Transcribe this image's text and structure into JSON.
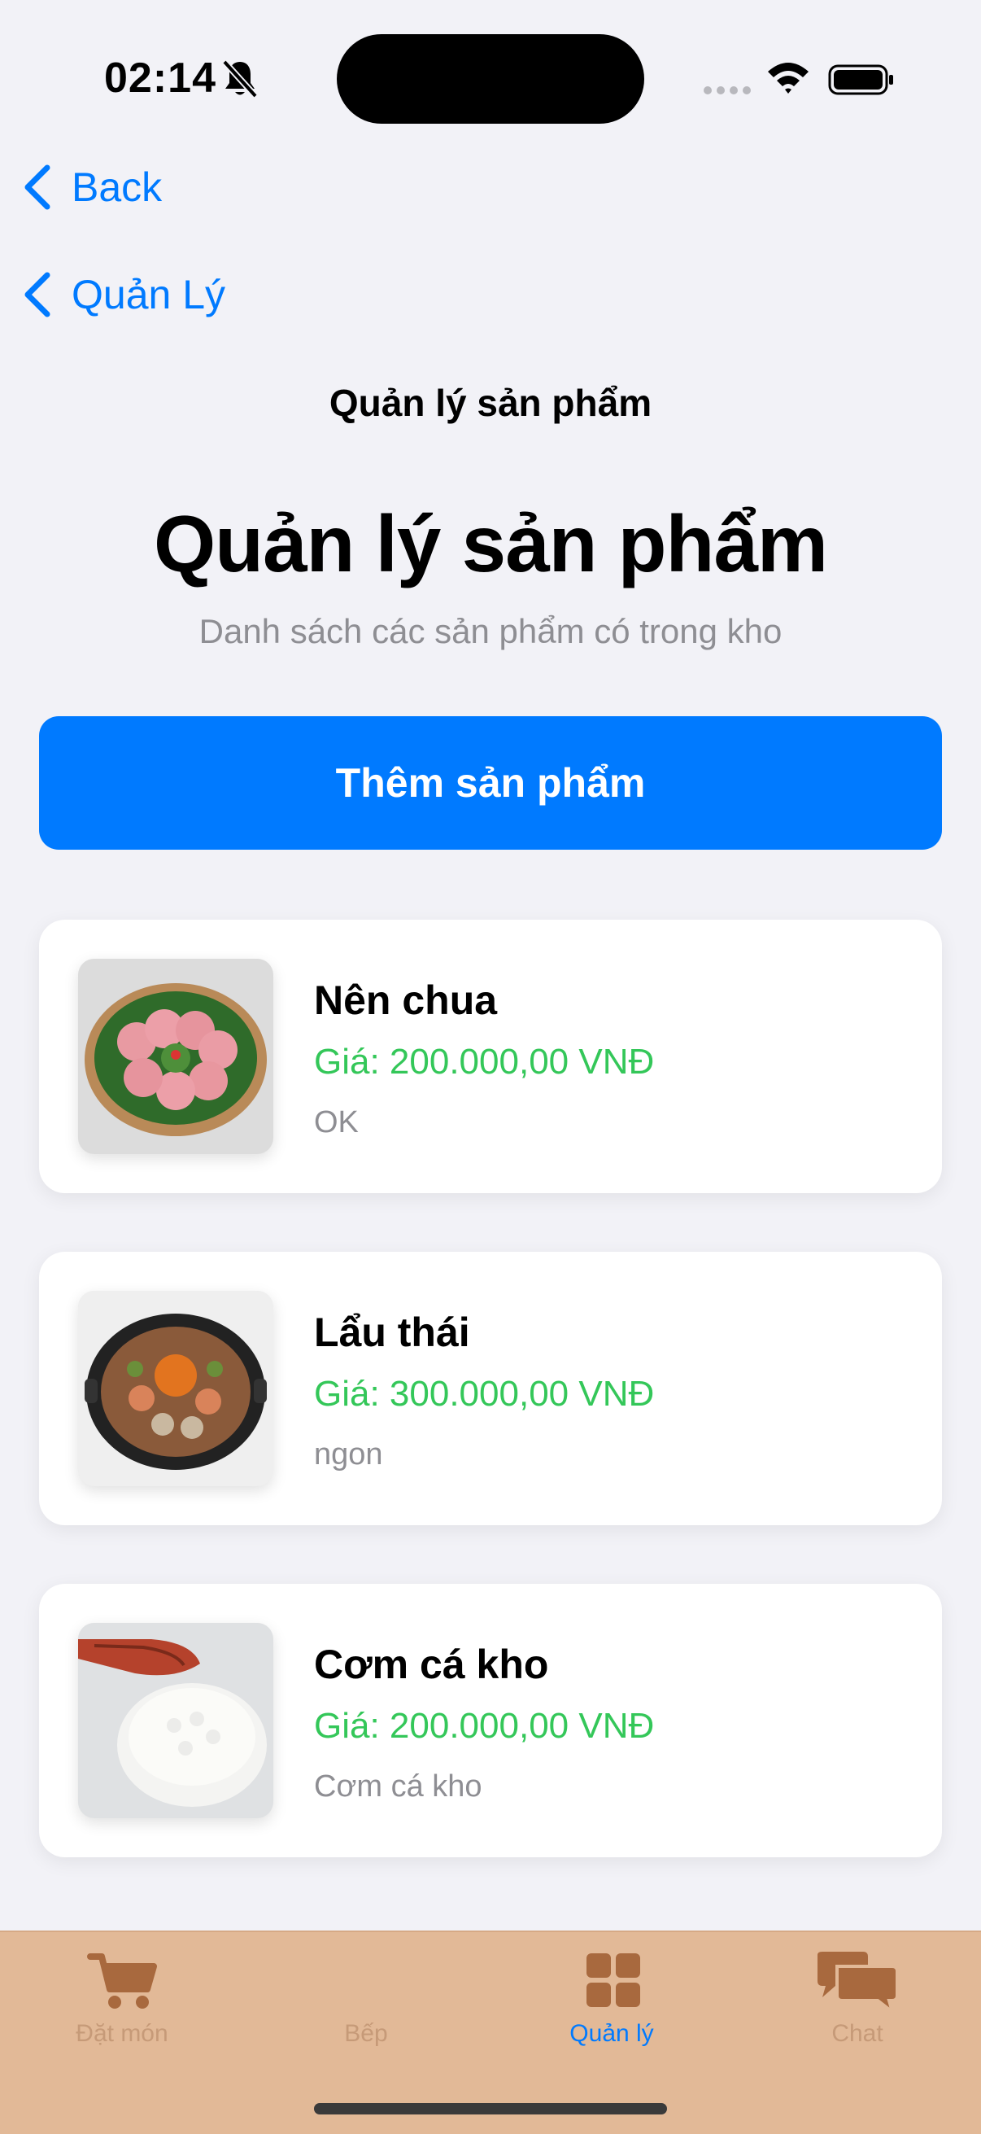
{
  "status_bar": {
    "time": "02:14"
  },
  "nav": {
    "back_label": "Back",
    "parent_label": "Quản Lý",
    "title": "Quản lý sản phẩm"
  },
  "header": {
    "title": "Quản lý sản phẩm",
    "subtitle": "Danh sách các sản phẩm có trong kho"
  },
  "add_button": {
    "label": "Thêm sản phẩm"
  },
  "products": [
    {
      "name": "Nên chua",
      "price": "Giá: 200.000,00 VNĐ",
      "note": "OK"
    },
    {
      "name": "Lẩu thái",
      "price": "Giá: 300.000,00 VNĐ",
      "note": "ngon"
    },
    {
      "name": "Cơm cá kho",
      "price": "Giá: 200.000,00 VNĐ",
      "note": "Cơm cá kho"
    }
  ],
  "tab_bar": {
    "tabs": [
      {
        "label": "Đặt món",
        "icon": "cart-icon"
      },
      {
        "label": "Bếp",
        "icon": "kitchen-icon"
      },
      {
        "label": "Quản lý",
        "icon": "grid-icon",
        "active": true
      },
      {
        "label": "Chat",
        "icon": "chat-bubbles-icon"
      }
    ]
  },
  "colors": {
    "accent": "#007aff",
    "price": "#34c759",
    "tab_bar_bg": "#e2b997",
    "tab_inactive": "#c69a78",
    "background": "#f2f2f7"
  }
}
